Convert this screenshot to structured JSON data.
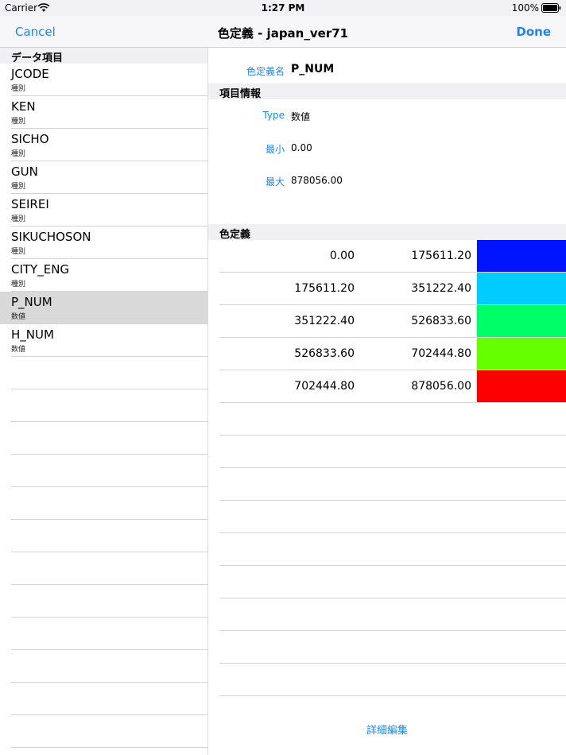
{
  "status_bar": {
    "carrier": "Carrier",
    "time": "1:27 PM",
    "battery": "100%"
  },
  "nav": {
    "cancel": "Cancel",
    "title": "色定義 - japan_ver71",
    "done": "Done"
  },
  "master": {
    "section_title": "データ項目",
    "items": [
      {
        "name": "JCODE",
        "type": "種別",
        "selected": false
      },
      {
        "name": "KEN",
        "type": "種別",
        "selected": false
      },
      {
        "name": "SICHO",
        "type": "種別",
        "selected": false
      },
      {
        "name": "GUN",
        "type": "種別",
        "selected": false
      },
      {
        "name": "SEIREI",
        "type": "種別",
        "selected": false
      },
      {
        "name": "SIKUCHOSON",
        "type": "種別",
        "selected": false
      },
      {
        "name": "CITY_ENG",
        "type": "種別",
        "selected": false
      },
      {
        "name": "P_NUM",
        "type": "数値",
        "selected": true
      },
      {
        "name": "H_NUM",
        "type": "数値",
        "selected": false
      }
    ]
  },
  "detail": {
    "name_label": "色定義名",
    "name_value": "P_NUM",
    "info_section": "項目情報",
    "info": [
      {
        "label": "Type",
        "value": "数値"
      },
      {
        "label": "最小",
        "value": "0.00"
      },
      {
        "label": "最大",
        "value": "878056.00"
      }
    ],
    "color_section": "色定義",
    "colors": [
      {
        "from": "0.00",
        "to": "175611.20",
        "color": "#0014ff"
      },
      {
        "from": "175611.20",
        "to": "351222.40",
        "color": "#00ccff"
      },
      {
        "from": "351222.40",
        "to": "526833.60",
        "color": "#00ff66"
      },
      {
        "from": "526833.60",
        "to": "702444.80",
        "color": "#66ff00"
      },
      {
        "from": "702444.80",
        "to": "878056.00",
        "color": "#ff0000"
      }
    ],
    "edit_label": "詳細編集"
  }
}
